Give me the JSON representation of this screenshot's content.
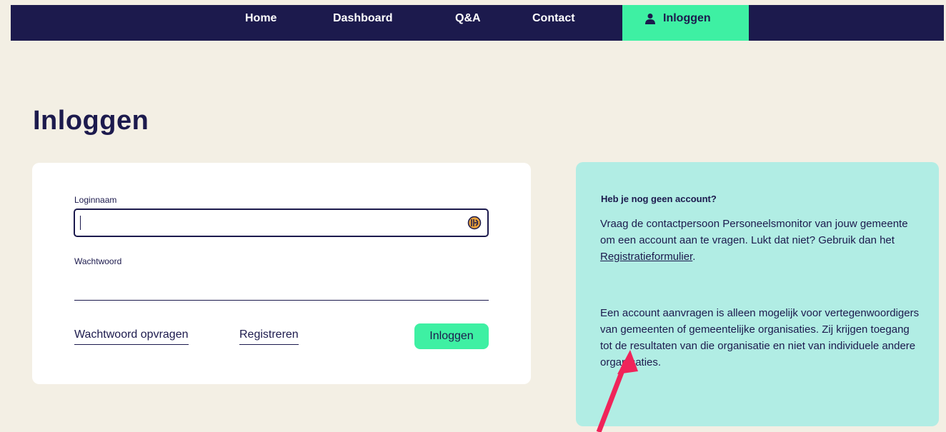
{
  "nav": {
    "home": "Home",
    "dashboard": "Dashboard",
    "qa": "Q&A",
    "contact": "Contact",
    "login": "Inloggen"
  },
  "page": {
    "title": "Inloggen"
  },
  "form": {
    "username_label": "Loginnaam",
    "username_value": "",
    "password_label": "Wachtwoord",
    "password_value": "",
    "forgot_link": "Wachtwoord opvragen",
    "register_link": "Registreren",
    "submit_label": "Inloggen"
  },
  "info": {
    "heading": "Heb je nog geen account?",
    "p1_text": "Vraag de contactpersoon Personeelsmonitor van jouw gemeente om een account aan te vragen. Lukt dat niet? Gebruik dan het ",
    "p1_link": "Registratieformulier",
    "p1_end": ".",
    "p2_text": "Een account aanvragen is alleen mogelijk voor vertegenwoordigers van gemeenten of gemeentelijke organisaties. Zij krijgen toegang tot de resultaten van die organisatie en niet van individuele andere organisaties."
  },
  "icons": {
    "user": "user-icon",
    "autofill": "password-manager-icon",
    "arrow": "annotation-arrow"
  },
  "colors": {
    "navy": "#1c1a4d",
    "accent_green": "#3ef0a3",
    "info_bg": "#b1ede4",
    "page_bg": "#f3efe4",
    "arrow": "#f0245a"
  }
}
